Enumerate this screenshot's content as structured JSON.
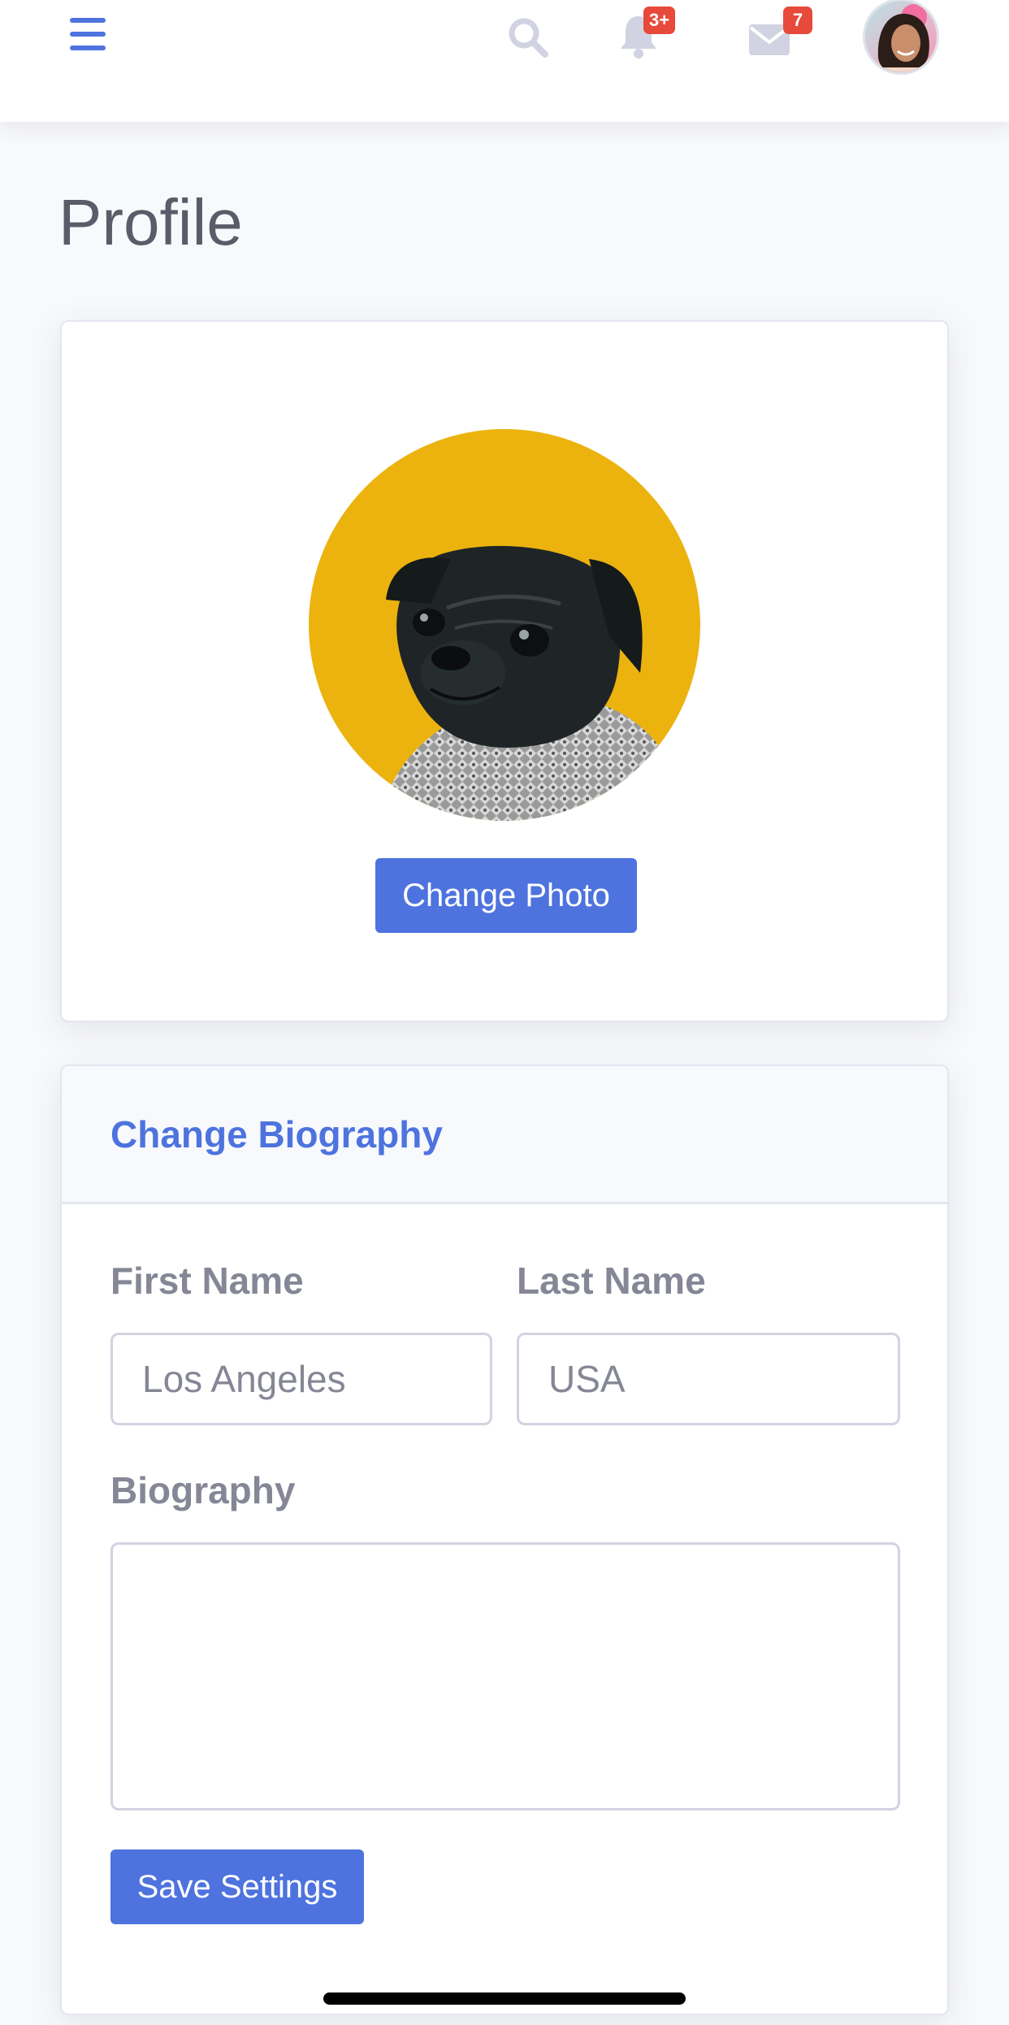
{
  "topbar": {
    "menu_icon": "hamburger-menu-icon",
    "search_icon": "search-icon",
    "alerts": {
      "icon": "bell-icon",
      "badge": "3+"
    },
    "messages": {
      "icon": "envelope-icon",
      "badge": "7"
    },
    "user_avatar": "avatar"
  },
  "page": {
    "title": "Profile"
  },
  "photo_card": {
    "photo": "profile-photo",
    "change_photo_label": "Change Photo"
  },
  "bio_card": {
    "header": "Change Biography",
    "first_name": {
      "label": "First Name",
      "placeholder": "Los Angeles",
      "value": ""
    },
    "last_name": {
      "label": "Last Name",
      "placeholder": "USA",
      "value": ""
    },
    "biography": {
      "label": "Biography",
      "value": ""
    },
    "save_label": "Save Settings"
  },
  "colors": {
    "primary": "#4e73df",
    "badge": "#e74a3b",
    "text_muted": "#858796",
    "title": "#5a5c69",
    "background": "#f8f9fc"
  }
}
